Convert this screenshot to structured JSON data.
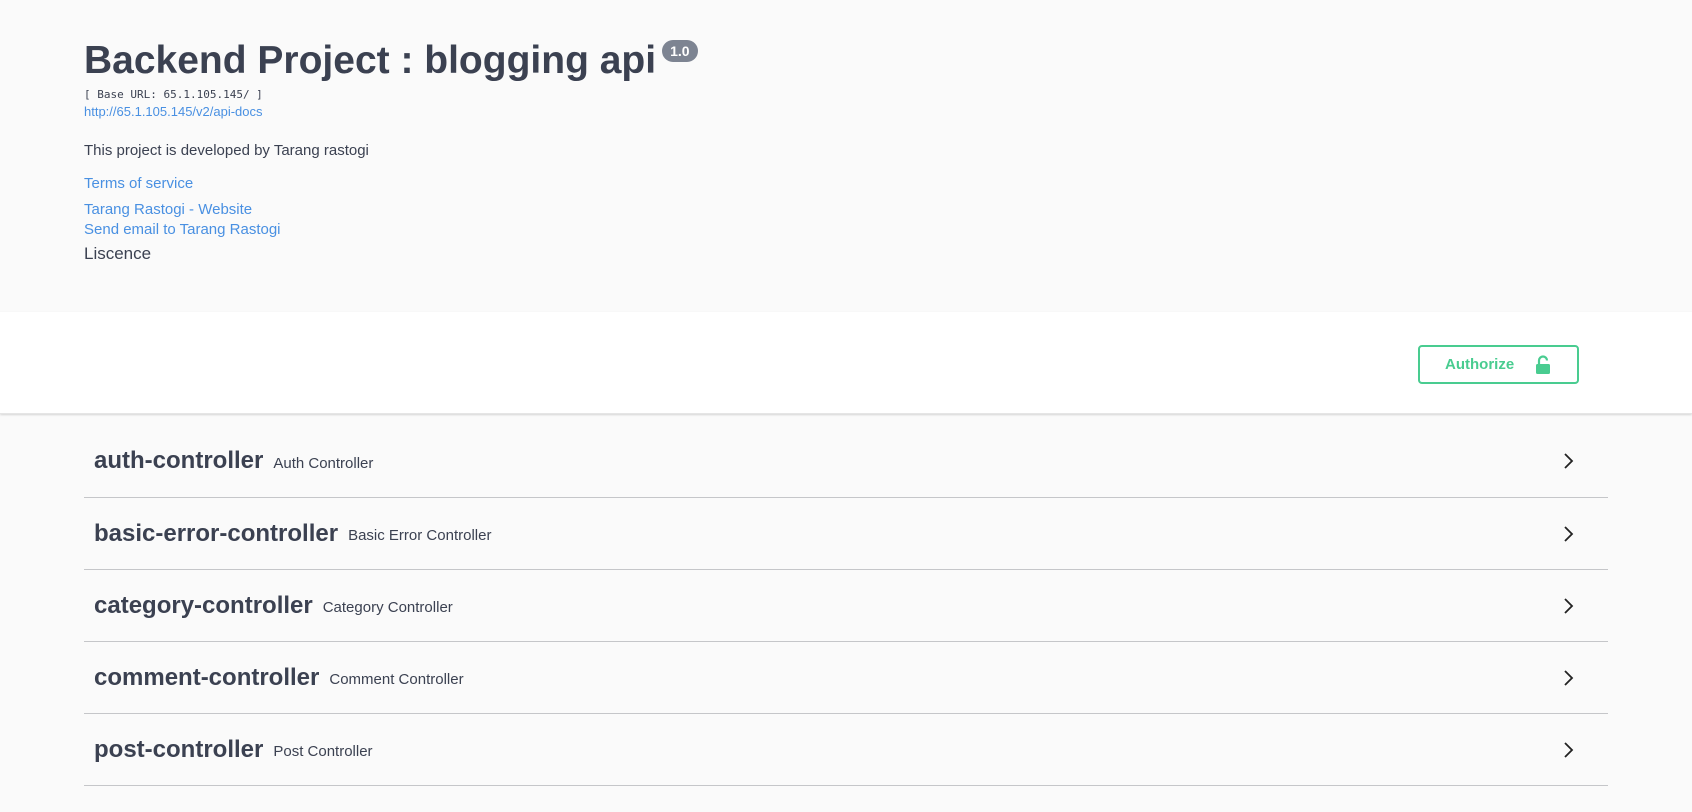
{
  "info": {
    "title": "Backend Project : blogging api",
    "version": "1.0",
    "base_url": "[ Base URL: 65.1.105.145/ ]",
    "api_docs_url": "http://65.1.105.145/v2/api-docs",
    "description": "This project is developed by Tarang rastogi",
    "terms_of_service": "Terms of service",
    "contact_website": "Tarang Rastogi - Website",
    "contact_email": "Send email to Tarang Rastogi",
    "license": "Liscence"
  },
  "authorize": {
    "label": "Authorize",
    "icon": "lock-open-icon",
    "color": "#49cc90"
  },
  "tags": [
    {
      "name": "auth-controller",
      "description": "Auth Controller"
    },
    {
      "name": "basic-error-controller",
      "description": "Basic Error Controller"
    },
    {
      "name": "category-controller",
      "description": "Category Controller"
    },
    {
      "name": "comment-controller",
      "description": "Comment Controller"
    },
    {
      "name": "post-controller",
      "description": "Post Controller"
    }
  ],
  "colors": {
    "link": "#4990e2",
    "text": "#3b4151",
    "badge": "#7d8492"
  }
}
